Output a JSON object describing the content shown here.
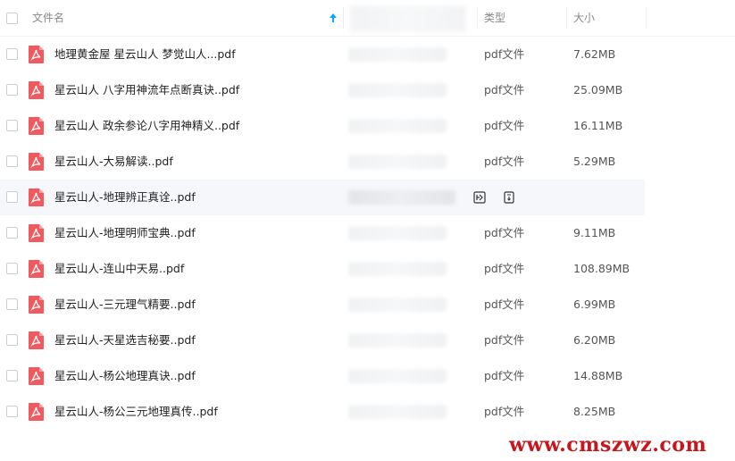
{
  "header": {
    "name_label": "文件名",
    "type_label": "类型",
    "size_label": "大小"
  },
  "files": [
    {
      "name": "地理黄金屋 星云山人 梦觉山人...pdf",
      "type": "pdf文件",
      "size": "7.62MB"
    },
    {
      "name": "星云山人 八字用神流年点断真诀..pdf",
      "type": "pdf文件",
      "size": "25.09MB"
    },
    {
      "name": "星云山人 政余参论八字用神精义..pdf",
      "type": "pdf文件",
      "size": "16.11MB"
    },
    {
      "name": "星云山人-大易解读..pdf",
      "type": "pdf文件",
      "size": "5.29MB"
    },
    {
      "name": "星云山人-地理辨正真诠..pdf",
      "type": "",
      "size": ""
    },
    {
      "name": "星云山人-地理明师宝典..pdf",
      "type": "pdf文件",
      "size": "9.11MB"
    },
    {
      "name": "星云山人-连山中天易..pdf",
      "type": "pdf文件",
      "size": "108.89MB"
    },
    {
      "name": "星云山人-三元理气精要..pdf",
      "type": "pdf文件",
      "size": "6.99MB"
    },
    {
      "name": "星云山人-天星选吉秘要..pdf",
      "type": "pdf文件",
      "size": "6.20MB"
    },
    {
      "name": "星云山人-杨公地理真诀..pdf",
      "type": "pdf文件",
      "size": "14.88MB"
    },
    {
      "name": "星云山人-杨公三元地理真传..pdf",
      "type": "pdf文件",
      "size": "8.25MB"
    }
  ],
  "watermark": "www.cmszwz.com",
  "colors": {
    "accent": "#06a7ff",
    "pdf_icon": "#f0595e",
    "watermark": "#c8161d"
  }
}
